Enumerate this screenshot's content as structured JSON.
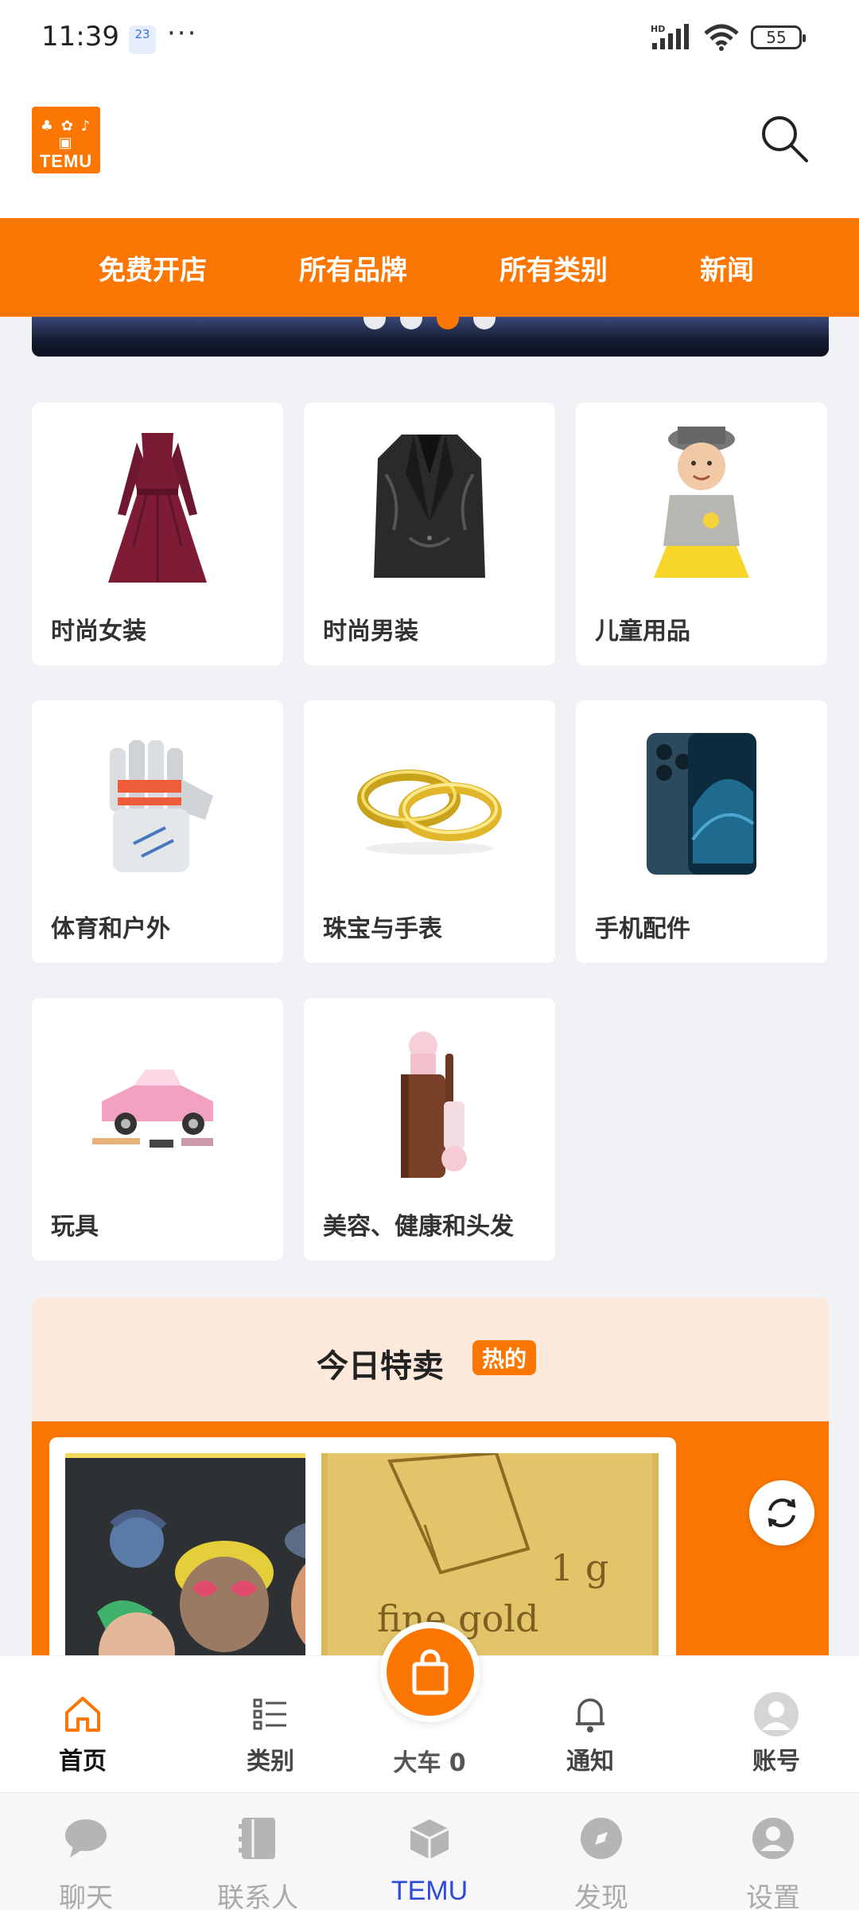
{
  "status_bar": {
    "time": "11:39",
    "date_badge": "23",
    "more": "···",
    "battery": "55",
    "network": "HD"
  },
  "header": {
    "logo_text": "TEMU",
    "search_icon": "search-icon"
  },
  "top_nav": {
    "items": [
      "免费开店",
      "所有品牌",
      "所有类别",
      "新闻"
    ]
  },
  "carousel": {
    "dot_count": 4,
    "active_index": 2
  },
  "categories": [
    {
      "label": "时尚女装",
      "icon": "dress-icon"
    },
    {
      "label": "时尚男装",
      "icon": "blazer-icon"
    },
    {
      "label": "儿童用品",
      "icon": "baby-icon"
    },
    {
      "label": "体育和户外",
      "icon": "glove-icon"
    },
    {
      "label": "珠宝与手表",
      "icon": "rings-icon"
    },
    {
      "label": "手机配件",
      "icon": "phone-icon"
    },
    {
      "label": "玩具",
      "icon": "toy-car-icon"
    },
    {
      "label": "美容、健康和头发",
      "icon": "cosmetics-icon"
    }
  ],
  "deals": {
    "title": "今日特卖",
    "badge": "热的",
    "gold_text_line1": "1 g",
    "gold_text_line2": "fine  gold"
  },
  "app_tabbar": {
    "home": "首页",
    "category": "类别",
    "cart": "大车 0",
    "notify": "通知",
    "account": "账号"
  },
  "host_bar": {
    "chat": "聊天",
    "contacts": "联系人",
    "temu": "TEMU",
    "discover": "发现",
    "settings": "设置"
  },
  "colors": {
    "brand_orange": "#fb7701",
    "host_active": "#2d4ad8"
  }
}
